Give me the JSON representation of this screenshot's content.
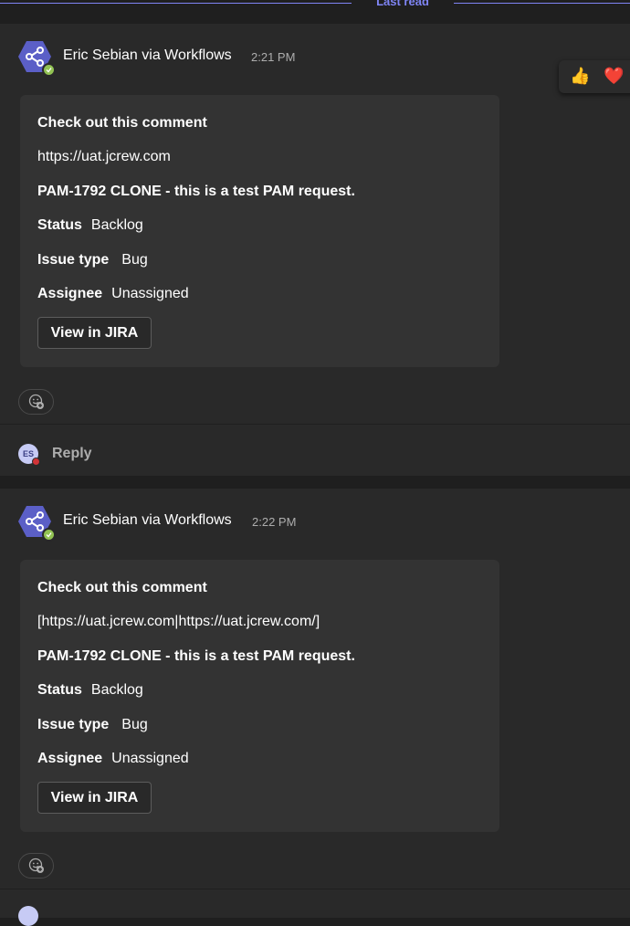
{
  "divider": {
    "label": "Last read"
  },
  "accent_color": "#7f85f5",
  "messages": [
    {
      "sender": "Eric Sebian via Workflows",
      "time": "2:21 PM",
      "avatar_icon": "workflows-share-icon",
      "card": {
        "title": "Check out this comment",
        "link": "https://uat.jcrew.com",
        "summary": "PAM-1792 CLONE - this is a test PAM request.",
        "facts": [
          {
            "label": "Status",
            "value": "Backlog"
          },
          {
            "label": "Issue type",
            "value": "Bug"
          },
          {
            "label": "Assignee",
            "value": "Unassigned"
          }
        ],
        "button": "View in JIRA"
      }
    },
    {
      "sender": "Eric Sebian via Workflows",
      "time": "2:22 PM",
      "avatar_icon": "workflows-share-icon",
      "card": {
        "title": "Check out this comment",
        "link": "[https://uat.jcrew.com|https://uat.jcrew.com/]",
        "summary": "PAM-1792 CLONE - this is a test PAM request.",
        "facts": [
          {
            "label": "Status",
            "value": "Backlog"
          },
          {
            "label": "Issue type",
            "value": "Bug"
          },
          {
            "label": "Assignee",
            "value": "Unassigned"
          }
        ],
        "button": "View in JIRA"
      }
    }
  ],
  "reactions": [
    "👍",
    "❤️"
  ],
  "reply": {
    "avatar_initials": "ES",
    "label": "Reply"
  }
}
